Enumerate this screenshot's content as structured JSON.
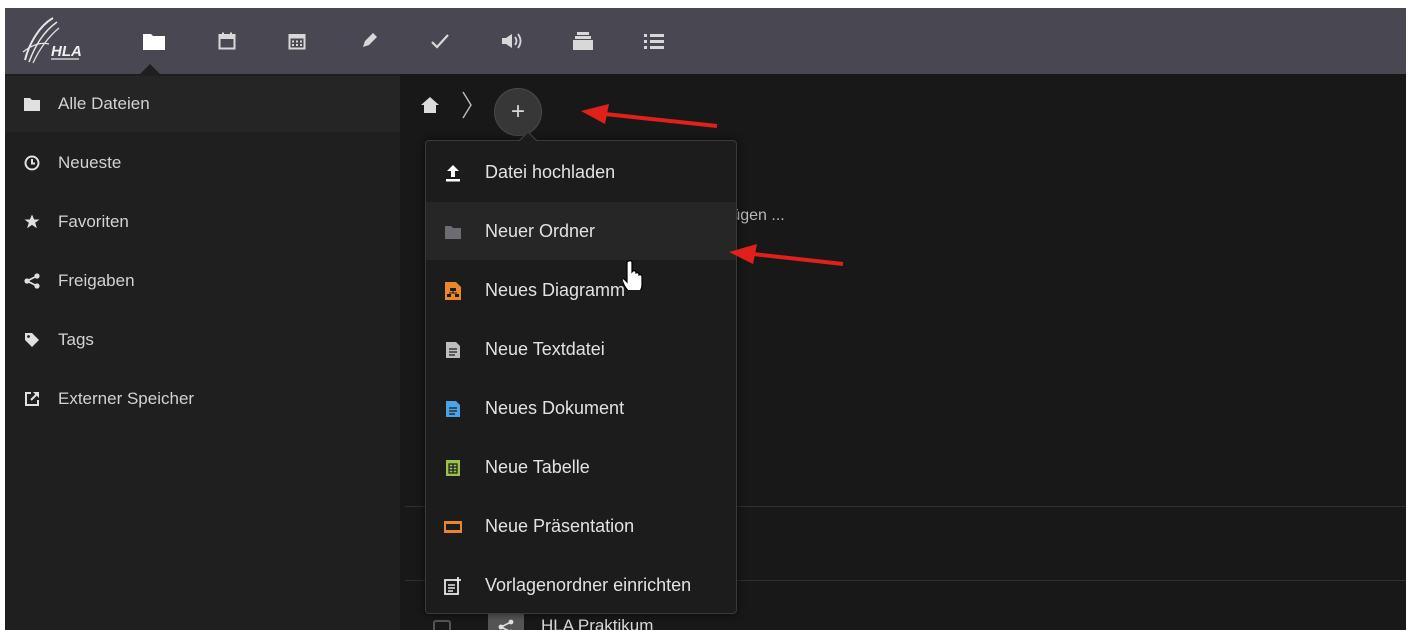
{
  "header": {
    "logo_text": "HLA",
    "apps": [
      {
        "icon": "folder-icon",
        "name": "Dateien"
      },
      {
        "icon": "calendar-icon"
      },
      {
        "icon": "calendar-grid-icon"
      },
      {
        "icon": "pencil-icon"
      },
      {
        "icon": "checkmark-icon"
      },
      {
        "icon": "speaker-icon"
      },
      {
        "icon": "archive-icon"
      },
      {
        "icon": "list-icon"
      }
    ]
  },
  "sidebar": {
    "items": [
      {
        "label": "Alle Dateien",
        "icon": "folder-icon",
        "active": true
      },
      {
        "label": "Neueste",
        "icon": "clock-icon"
      },
      {
        "label": "Favoriten",
        "icon": "star-icon"
      },
      {
        "label": "Freigaben",
        "icon": "share-icon"
      },
      {
        "label": "Tags",
        "icon": "tag-icon"
      },
      {
        "label": "Externer Speicher",
        "icon": "external-link-icon"
      }
    ]
  },
  "main": {
    "add_button_label": "+",
    "empty_hint": "ufügen ...",
    "row": {
      "name": "HLA Praktikum",
      "icon": "share-icon"
    }
  },
  "new_menu": {
    "items": [
      {
        "label": "Datei hochladen",
        "icon": "upload-icon"
      },
      {
        "label": "Neuer Ordner",
        "icon": "folder-icon",
        "hovered": true
      },
      {
        "label": "Neues Diagramm",
        "icon": "diagram-icon",
        "color": "#e8872c"
      },
      {
        "label": "Neue Textdatei",
        "icon": "text-file-icon",
        "color": "#bdbdbd"
      },
      {
        "label": "Neues Dokument",
        "icon": "document-icon",
        "color": "#4aa3e6"
      },
      {
        "label": "Neue Tabelle",
        "icon": "spreadsheet-icon",
        "color": "#9bc34f"
      },
      {
        "label": "Neue Präsentation",
        "icon": "presentation-icon",
        "color": "#e8862c"
      },
      {
        "label": "Vorlagenordner einrichten",
        "icon": "template-icon"
      }
    ]
  },
  "colors": {
    "header_bg": "#494852",
    "sidebar_bg": "#1f1f1f",
    "content_bg": "#181818",
    "annotation_arrow": "#e0201a"
  }
}
